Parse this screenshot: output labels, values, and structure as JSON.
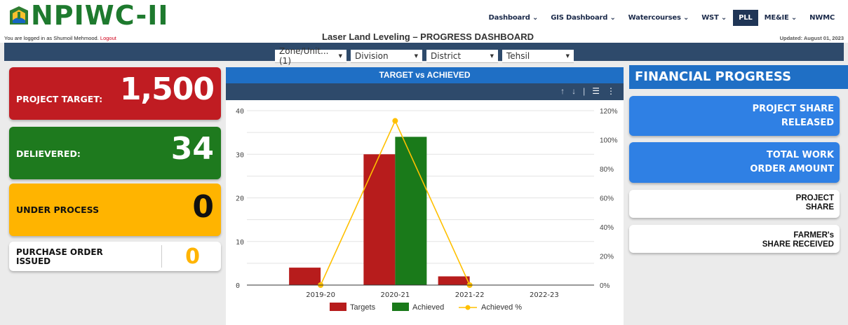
{
  "header": {
    "logo_text": "NPIWC-II",
    "login_prefix": "You are logged in as Shumoil Mehmood.",
    "logout_label": "Logout",
    "page_title": "Laser Land Leveling – PROGRESS DASHBOARD",
    "updated": "Updated: August 01, 2023"
  },
  "nav": {
    "items": [
      {
        "label": "Dashboard ⌄"
      },
      {
        "label": "GIS Dashboard ⌄"
      },
      {
        "label": "Watercourses ⌄"
      },
      {
        "label": "WST ⌄"
      },
      {
        "label": "PLL"
      },
      {
        "label": "ME&IE ⌄"
      },
      {
        "label": "NWMC"
      }
    ],
    "active": "PLL"
  },
  "filters": {
    "zone": "Zone/Unit...(1)",
    "division": "Division",
    "district": "District",
    "tehsil": "Tehsil"
  },
  "kpis": {
    "project_target_label": "PROJECT TARGET:",
    "project_target_value": "1,500",
    "delivered_label": "DELIEVERED:",
    "delivered_value": "34",
    "under_process_label": "UNDER PROCESS",
    "under_process_value": "0",
    "purchase_order_label": "PURCHASE ORDER ISSUED",
    "purchase_order_value": "0"
  },
  "chart_panel": {
    "title": "TARGET vs ACHIEVED"
  },
  "chart_data": {
    "type": "bar",
    "categories": [
      "2019-20",
      "2020-21",
      "2021-22",
      "2022-23"
    ],
    "series": [
      {
        "name": "Targets",
        "values": [
          4,
          30,
          2,
          0
        ],
        "color": "#b71c1c"
      },
      {
        "name": "Achieved",
        "values": [
          0,
          34,
          0,
          0
        ],
        "color": "#1a7a1a"
      },
      {
        "name": "Achieved %",
        "type": "line",
        "axis": "right",
        "values": [
          0,
          113,
          0,
          null
        ],
        "color": "#ffc000"
      }
    ],
    "y_left": {
      "ticks": [
        0,
        10,
        20,
        30,
        40
      ],
      "lim": [
        0,
        40
      ]
    },
    "y_right": {
      "ticks": [
        "0%",
        "20%",
        "40%",
        "60%",
        "80%",
        "100%",
        "120%"
      ],
      "lim": [
        0,
        120
      ]
    },
    "legend_position": "bottom"
  },
  "financial": {
    "title": "FINANCIAL PROGRESS",
    "cards": [
      {
        "line1": "PROJECT SHARE",
        "line2": "RELEASED"
      },
      {
        "line1": "TOTAL WORK",
        "line2": "ORDER AMOUNT"
      },
      {
        "line1": "PROJECT",
        "line2": "SHARE"
      },
      {
        "line1": "FARMER's",
        "line2": "SHARE RECEIVED"
      }
    ]
  },
  "colors": {
    "brand_green": "#1e7a2e",
    "nav_dark": "#1f3556",
    "accent_blue": "#1f6fc5",
    "target_red": "#c01c22",
    "delivered_green": "#1e7a1e",
    "process_amber": "#ffb400"
  }
}
